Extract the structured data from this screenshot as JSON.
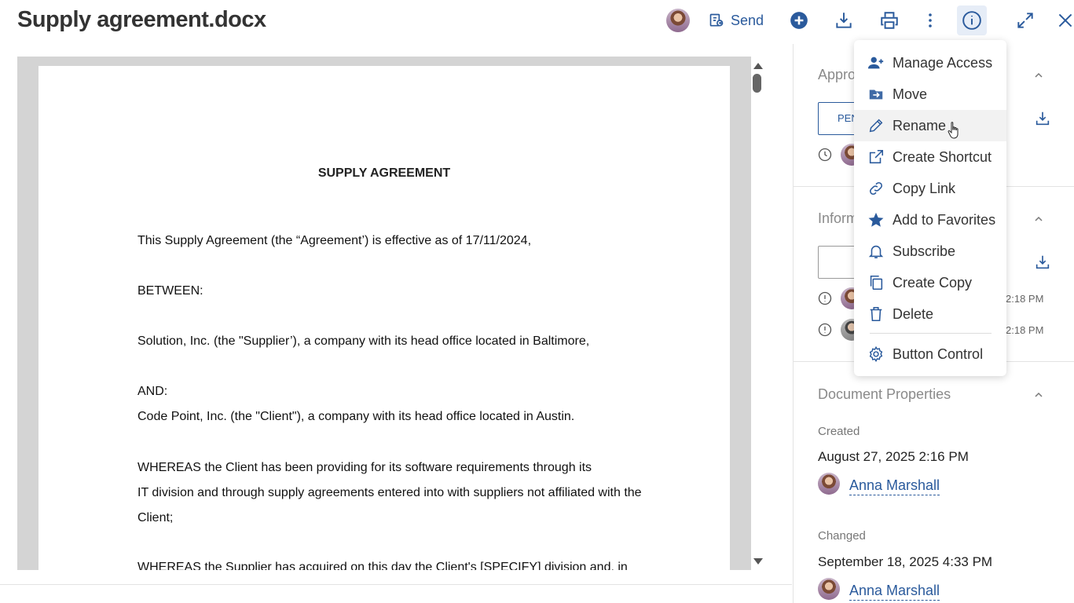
{
  "header": {
    "title": "Supply agreement.docx",
    "send_label": "Send",
    "icons": [
      "add-icon",
      "download-icon",
      "print-icon",
      "more-icon",
      "info-icon",
      "expand-icon",
      "close-icon"
    ]
  },
  "document": {
    "title": "SUPPLY AGREEMENT",
    "lines": [
      "This Supply Agreement (the “Agreement’) is effective as of 17/11/2024,",
      "BETWEEN:",
      "Solution, Inc. (the \"Supplier’), a company with its head office located in Baltimore,",
      "AND:",
      "Code Point, Inc. (the \"Client\"), a company with its head office located in Austin.",
      "WHEREAS the Client has been providing for its software requirements through its",
      "IT division and through supply agreements entered into with suppliers not affiliated with the",
      "Client;",
      "WHEREAS the Supplier has acquired on this day the Client's [SPECIFY] division and, in"
    ]
  },
  "panel": {
    "approval": {
      "title": "Appro",
      "status": "PEN"
    },
    "info": {
      "title": "Inform",
      "time1": "2:18 PM",
      "time2": "2:18 PM"
    },
    "properties": {
      "title": "Document Properties",
      "created_label": "Created",
      "created_value": "August 27, 2025 2:16 PM",
      "created_user": "Anna Marshall",
      "changed_label": "Changed",
      "changed_value": "September 18, 2025 4:33 PM",
      "changed_user": "Anna Marshall"
    }
  },
  "menu": {
    "items": [
      {
        "label": "Manage Access",
        "icon": "user-add-icon"
      },
      {
        "label": "Move",
        "icon": "move-icon"
      },
      {
        "label": "Rename",
        "icon": "pencil-icon",
        "hovered": true
      },
      {
        "label": "Create Shortcut",
        "icon": "external-link-icon"
      },
      {
        "label": "Copy Link",
        "icon": "link-icon"
      },
      {
        "label": "Add to Favorites",
        "icon": "star-icon"
      },
      {
        "label": "Subscribe",
        "icon": "bell-icon"
      },
      {
        "label": "Create Copy",
        "icon": "copy-icon"
      },
      {
        "label": "Delete",
        "icon": "trash-icon"
      },
      {
        "label": "Button Control",
        "icon": "gear-icon"
      }
    ]
  },
  "colors": {
    "accent": "#2a5a9c",
    "hover": "#f2f2f2",
    "viewer_bg": "#d4d4d4"
  }
}
